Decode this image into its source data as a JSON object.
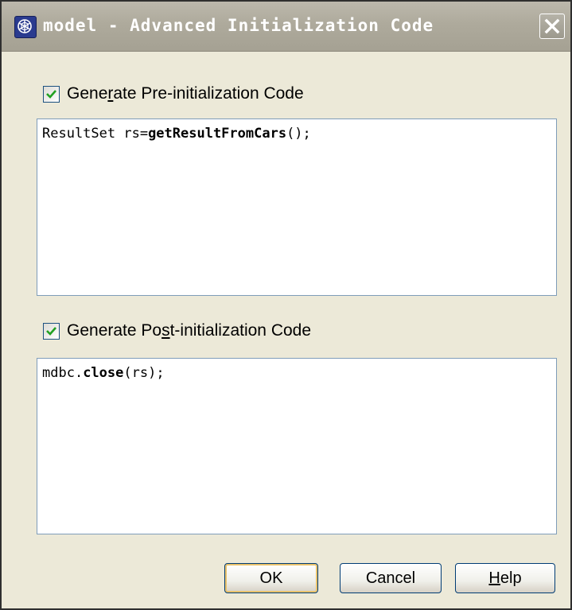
{
  "window": {
    "title": "model - Advanced Initialization Code",
    "app_icon": "netbeans-cube-icon",
    "close_icon": "close-icon"
  },
  "pre_init": {
    "checked": true,
    "label_before": "Gene",
    "label_mnemonic": "r",
    "label_after": "ate Pre-initialization Code",
    "code": [
      {
        "text": "ResultSet rs=",
        "bold": false
      },
      {
        "text": "getResultFromCars",
        "bold": true
      },
      {
        "text": "();",
        "bold": false
      }
    ]
  },
  "post_init": {
    "checked": true,
    "label_before": "Generate Po",
    "label_mnemonic": "s",
    "label_after": "t-initialization Code",
    "code": [
      {
        "text": "mdbc.",
        "bold": false
      },
      {
        "text": "close",
        "bold": true
      },
      {
        "text": "(rs);",
        "bold": false
      }
    ]
  },
  "buttons": {
    "ok_label": "OK",
    "cancel_label": "Cancel",
    "help_mnemonic": "H",
    "help_rest": "elp"
  },
  "colors": {
    "checkmark": "#21a121",
    "checkbox_border": "#1c5180",
    "input_border": "#7f9db9",
    "dialog_bg": "#ece9d8"
  }
}
